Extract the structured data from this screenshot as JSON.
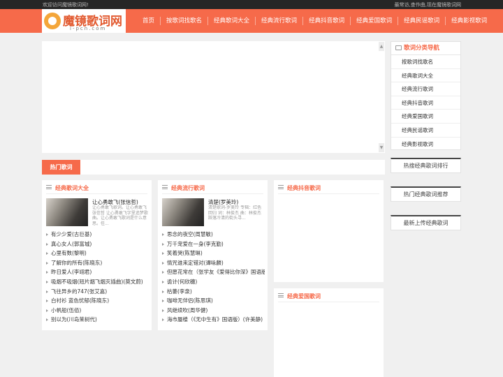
{
  "topbar": {
    "welcome": "欢迎访问魔镜歌词网!",
    "right": "最常访,查作曲,现在魔镜歌词网"
  },
  "logo": {
    "name": "魔镜歌词网",
    "domain": "i-pcn.com"
  },
  "nav": [
    "首页",
    "按歌词找歌名",
    "经典歌词大全",
    "经典流行歌词",
    "经典抖音歌词",
    "经典爱国歌词",
    "经典民谣歌词",
    "经典影视歌词"
  ],
  "sidebar": {
    "title": "歌词分类导航",
    "links": [
      "按歌词找歌名",
      "经典歌词大全",
      "经典流行歌词",
      "经典抖音歌词",
      "经典爱国歌词",
      "经典民谣歌词",
      "经典影视歌词"
    ],
    "panels": [
      "热搜经典歌词排行",
      "热门经典歌词推荐",
      "最新上传经典歌词"
    ]
  },
  "hot_tab": "热门歌词",
  "sections": {
    "classic": {
      "title": "经典歌词大全",
      "feature": {
        "title": "让心勇敢飞(张信哲)",
        "desc": "让心勇敢飞歌词。让心勇敢飞 张信哲 让心勇敢飞字里追梦歌曲。让心勇敢飞歌词是什么意思。任..."
      },
      "songs": [
        "有少少爱(古巨基)",
        "真心女人(郭富城)",
        "心里有数(黎明)",
        "了解你的所有(陈晓东)",
        "昨日爱人(李翊君)",
        "吸烟不吸烟(短片烟飞烟灭插曲)(莫文蔚)",
        "飞往异乡的747(张艾嘉)",
        "白衬衫 蓝色忧郁(陈晓东)",
        "小帆船(伍佰)",
        "别以为(川岛茉树代)"
      ]
    },
    "pop": {
      "title": "经典流行歌词",
      "feature": {
        "title": "清楚(罗美玲)",
        "desc": "清楚歌词-罗美玲 专辑：红色回归 词：林俊杰 曲：林俊杰 踩落冷清的街头寻..."
      },
      "songs": [
        "思念的夜空(周慧敏)",
        "万千宠爱在一身(李克勤)",
        "笑着哭(陈慧琳)",
        "情咒谁来定错对(谭咏麟)",
        "但愿花常在（张学友《爱得比你深》国语版...",
        "诡计(何欣穗)",
        "枯萎(李泉)",
        "咖啡无伴侣(陈思琪)",
        "风继续吹(周华健)",
        "海市蜃楼（《无中生有》国语版）(许美静)"
      ]
    },
    "douyin": {
      "title": "经典抖音歌词"
    },
    "patriotic": {
      "title": "经典爱国歌词"
    }
  },
  "colors": {
    "accent": "#f66a4a",
    "topbar": "#262626",
    "background": "#f0f0f0"
  }
}
